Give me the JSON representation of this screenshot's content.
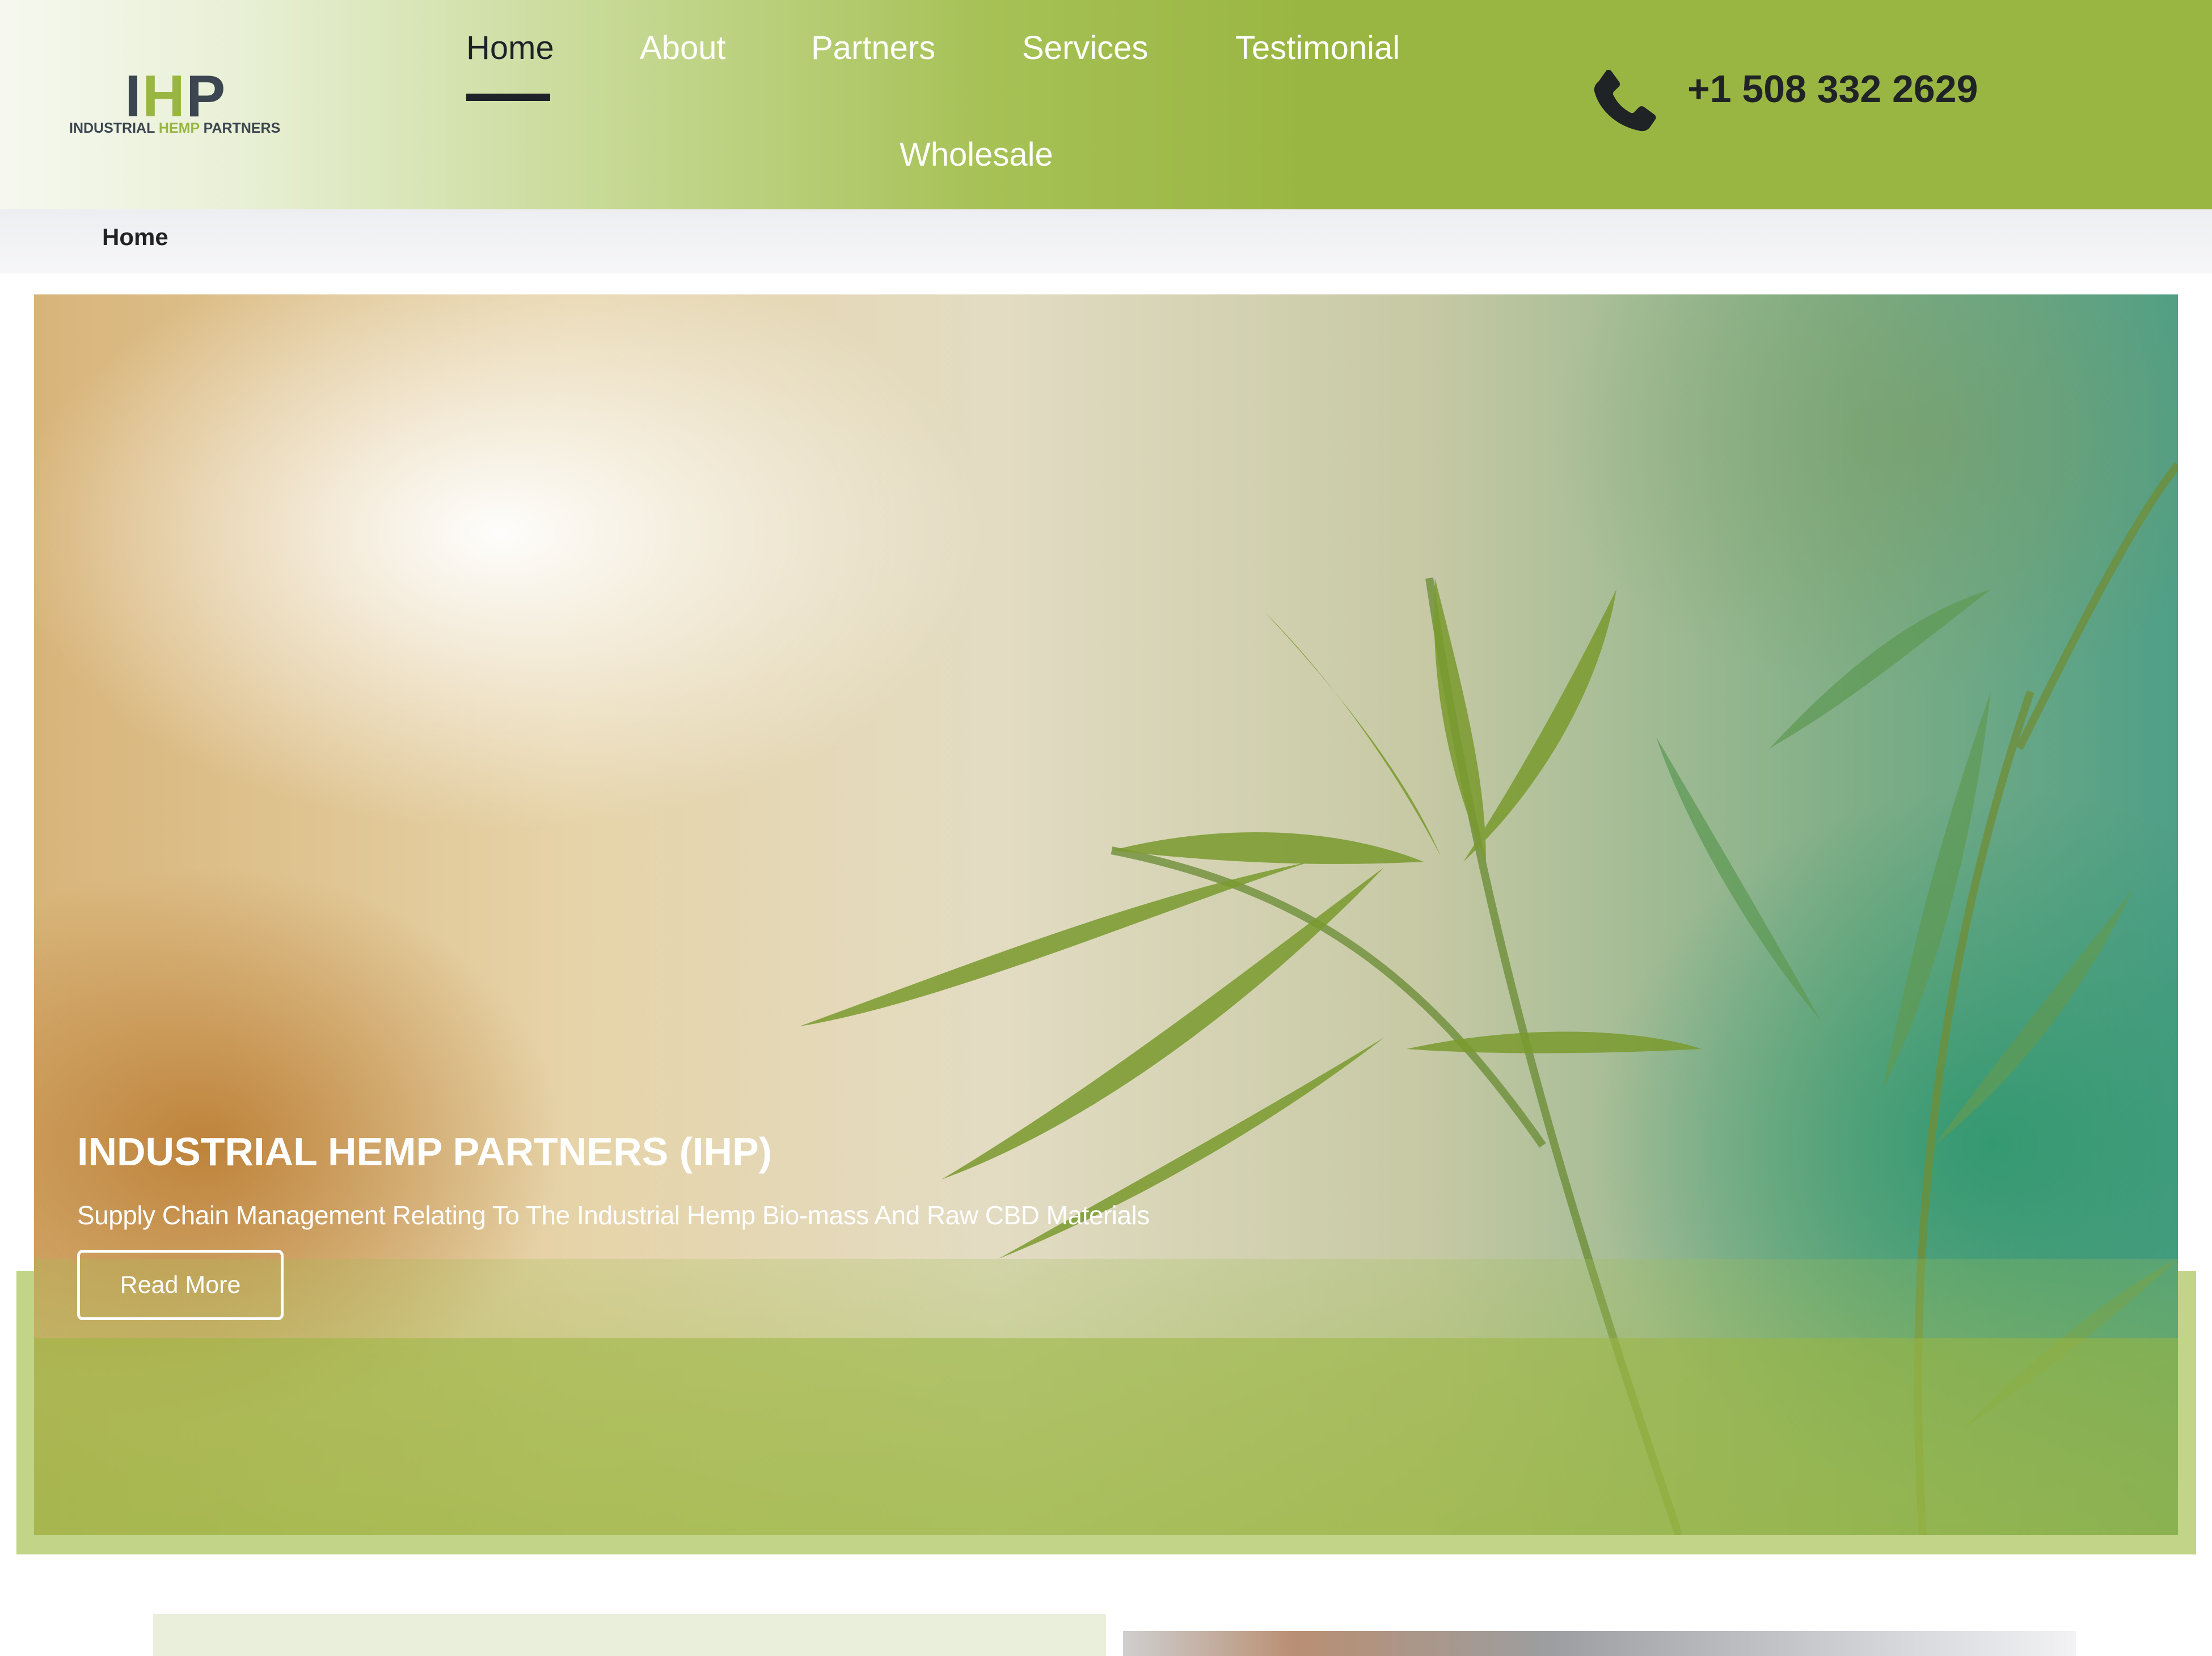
{
  "brand": {
    "mark_left": "I",
    "mark_h": "H",
    "mark_right": "P",
    "text_industrial": "INDUSTRIAL",
    "text_hemp": "HEMP",
    "text_partners": "PARTNERS"
  },
  "nav": {
    "items": [
      {
        "label": "Home",
        "active": true
      },
      {
        "label": "About"
      },
      {
        "label": "Partners"
      },
      {
        "label": "Services"
      },
      {
        "label": "Testimonial"
      },
      {
        "label": "Wholesale"
      }
    ]
  },
  "contact": {
    "icon": "phone-icon",
    "phone": "+1 508 332 2629"
  },
  "breadcrumb": {
    "current": "Home"
  },
  "hero": {
    "title": "INDUSTRIAL HEMP PARTNERS (IHP)",
    "subtitle": "Supply Chain Management Relating To The Industrial Hemp Bio-mass And Raw CBD Materials",
    "button_label": "Read More"
  },
  "colors": {
    "brand_green": "#9ab642",
    "header_text_dark": "#1e2228",
    "logo_gray": "#3b4650"
  }
}
